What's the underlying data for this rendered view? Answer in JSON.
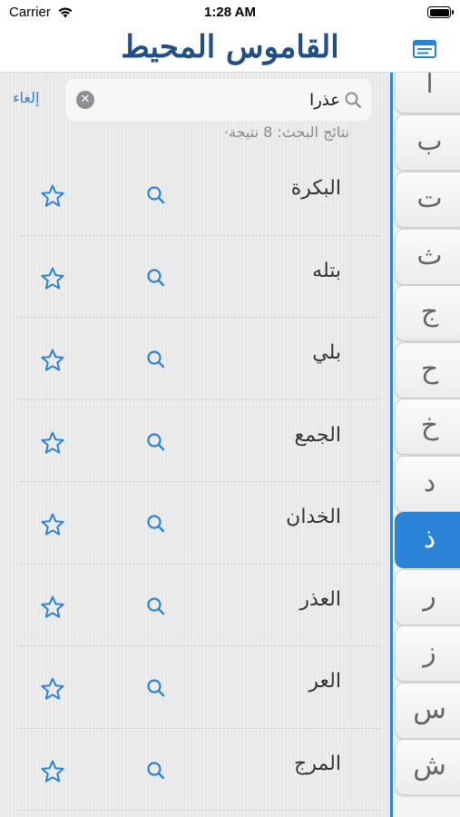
{
  "status": {
    "carrier": "Carrier",
    "time": "1:28 AM"
  },
  "nav": {
    "title": "القاموس المحيط",
    "menu_icon": "list-icon"
  },
  "search": {
    "query": "عذرا",
    "cancel_label": "إلغاء"
  },
  "results_text": "نتائج البحث:  8 نتيجة·",
  "results": [
    {
      "word": "البكرة"
    },
    {
      "word": "بتله"
    },
    {
      "word": "بلي"
    },
    {
      "word": "الجمع"
    },
    {
      "word": "الخدان"
    },
    {
      "word": "العذر"
    },
    {
      "word": "العر"
    },
    {
      "word": "المرج"
    }
  ],
  "alphabet": [
    "أ",
    "ب",
    "ت",
    "ث",
    "ج",
    "ح",
    "خ",
    "د",
    "ذ",
    "ر",
    "ز",
    "س",
    "ش"
  ],
  "active_letter": "ذ",
  "colors": {
    "accent": "#2a83d6",
    "title": "#1f4f86"
  }
}
